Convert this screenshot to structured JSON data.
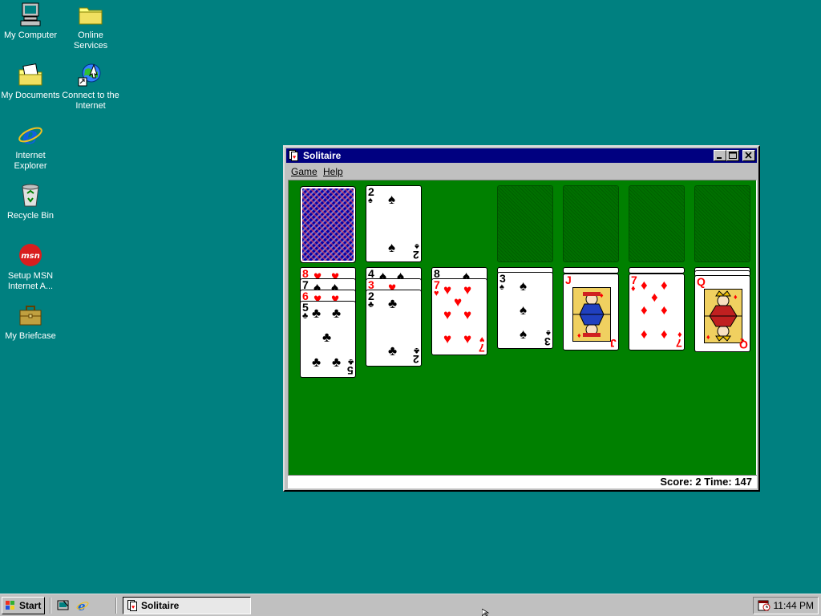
{
  "desktop": {
    "icons": [
      {
        "label": "My Computer",
        "icon": "computer-icon"
      },
      {
        "label": "Online Services",
        "icon": "folder-icon"
      },
      {
        "label": "My Documents",
        "icon": "documents-folder-icon"
      },
      {
        "label": "Connect to the Internet",
        "icon": "connect-internet-icon"
      },
      {
        "label": "Internet Explorer",
        "icon": "ie-icon"
      },
      {
        "label": "Recycle Bin",
        "icon": "recycle-bin-icon"
      },
      {
        "label": "Setup MSN Internet A...",
        "icon": "msn-icon",
        "logo_text": "msn"
      },
      {
        "label": "My Briefcase",
        "icon": "briefcase-icon"
      }
    ],
    "background_color": "#008080"
  },
  "window": {
    "title": "Solitaire",
    "menu": [
      {
        "label": "Game"
      },
      {
        "label": "Help"
      }
    ],
    "status": "Score: 2 Time: 147",
    "felt_color": "#008000",
    "stock": {
      "face_down": true
    },
    "waste": {
      "rank": "2",
      "suit": "spade"
    },
    "foundations": [
      {
        "empty": true
      },
      {
        "empty": true
      },
      {
        "empty": true
      },
      {
        "empty": true
      }
    ],
    "tableau": [
      {
        "cards": [
          {
            "rank": "8",
            "suit": "heart"
          },
          {
            "rank": "7",
            "suit": "spade"
          },
          {
            "rank": "6",
            "suit": "heart"
          },
          {
            "rank": "5",
            "suit": "club"
          }
        ]
      },
      {
        "cards": [
          {
            "rank": "4",
            "suit": "spade"
          },
          {
            "rank": "3",
            "suit": "heart"
          },
          {
            "rank": "2",
            "suit": "club"
          }
        ]
      },
      {
        "cards": [
          {
            "rank": "8",
            "suit": "spade"
          },
          {
            "rank": "7",
            "suit": "heart"
          }
        ]
      },
      {
        "cards": [
          {
            "rank": "3",
            "suit": "spade"
          }
        ]
      },
      {
        "cards": [
          {
            "rank": "J",
            "suit": "diamond"
          }
        ]
      },
      {
        "cards": [
          {
            "rank": "7",
            "suit": "diamond"
          }
        ]
      },
      {
        "cards": [
          {
            "rank": "Q",
            "suit": "diamond"
          }
        ]
      }
    ]
  },
  "taskbar": {
    "start_label": "Start",
    "quick_launch": [
      {
        "icon": "show-desktop-icon"
      },
      {
        "icon": "ie-quicklaunch-icon"
      }
    ],
    "tasks": [
      {
        "label": "Solitaire",
        "icon": "solitaire-icon"
      }
    ],
    "clock": "11:44 PM",
    "tray_icon": "scheduler-icon"
  }
}
